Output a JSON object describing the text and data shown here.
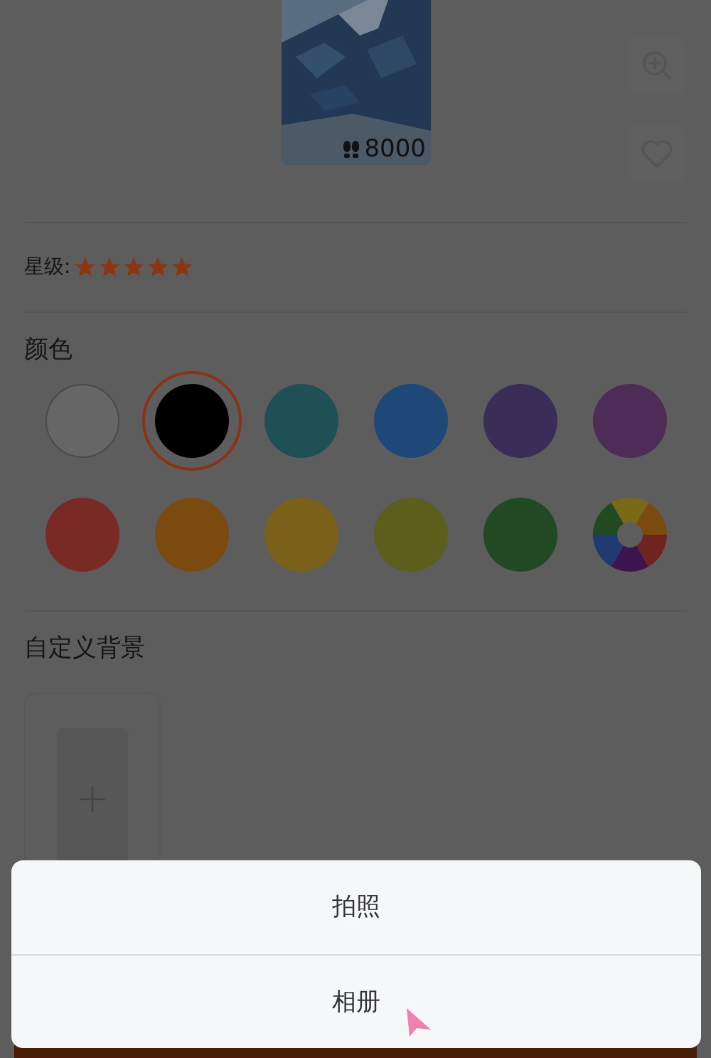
{
  "card": {
    "steps": "8000"
  },
  "rating": {
    "label": "星级:",
    "stars": 5
  },
  "colors": {
    "title": "颜色",
    "swatches": [
      {
        "kind": "solid",
        "color": "#666666",
        "selected": false
      },
      {
        "kind": "solid",
        "color": "#000000",
        "selected": true
      },
      {
        "kind": "solid",
        "color": "#1f5056",
        "selected": false
      },
      {
        "kind": "solid",
        "color": "#1e4878",
        "selected": false
      },
      {
        "kind": "solid",
        "color": "#3a2e58",
        "selected": false
      },
      {
        "kind": "solid",
        "color": "#4e2c58",
        "selected": false
      },
      {
        "kind": "solid",
        "color": "#7a2a24",
        "selected": false
      },
      {
        "kind": "solid",
        "color": "#7a4a0e",
        "selected": false
      },
      {
        "kind": "solid",
        "color": "#7a6018",
        "selected": false
      },
      {
        "kind": "solid",
        "color": "#5c5e1c",
        "selected": false
      },
      {
        "kind": "solid",
        "color": "#224a22",
        "selected": false
      },
      {
        "kind": "wheel",
        "selected": false
      }
    ]
  },
  "background": {
    "title": "自定义背景"
  },
  "sheet": {
    "options": [
      "拍照",
      "相册"
    ]
  }
}
